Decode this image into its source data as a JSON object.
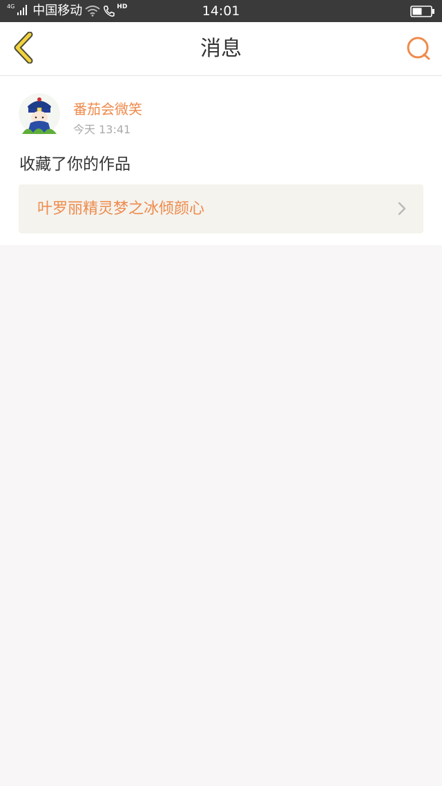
{
  "status_bar": {
    "network_type": "4G",
    "carrier": "中国移动",
    "hd_label": "HD",
    "time": "14:01",
    "icons": [
      "signal-icon",
      "wifi-icon",
      "call-icon",
      "battery-icon"
    ]
  },
  "nav": {
    "title": "消息",
    "back_icon": "chevron-left-icon",
    "action_icon": "comment-icon",
    "accent_color": "#ef8a4b"
  },
  "message": {
    "user_name": "番茄会微笑",
    "time": "今天 13:41",
    "text": "收藏了你的作品",
    "work_title": "叶罗丽精灵梦之冰倾颜心",
    "avatar_icon": "avatar-image"
  },
  "colors": {
    "status_bar_bg": "#3a3a3a",
    "accent": "#ef8a4b",
    "back_icon_yellow": "#f2d23c",
    "page_bg": "#f8f6f6"
  }
}
